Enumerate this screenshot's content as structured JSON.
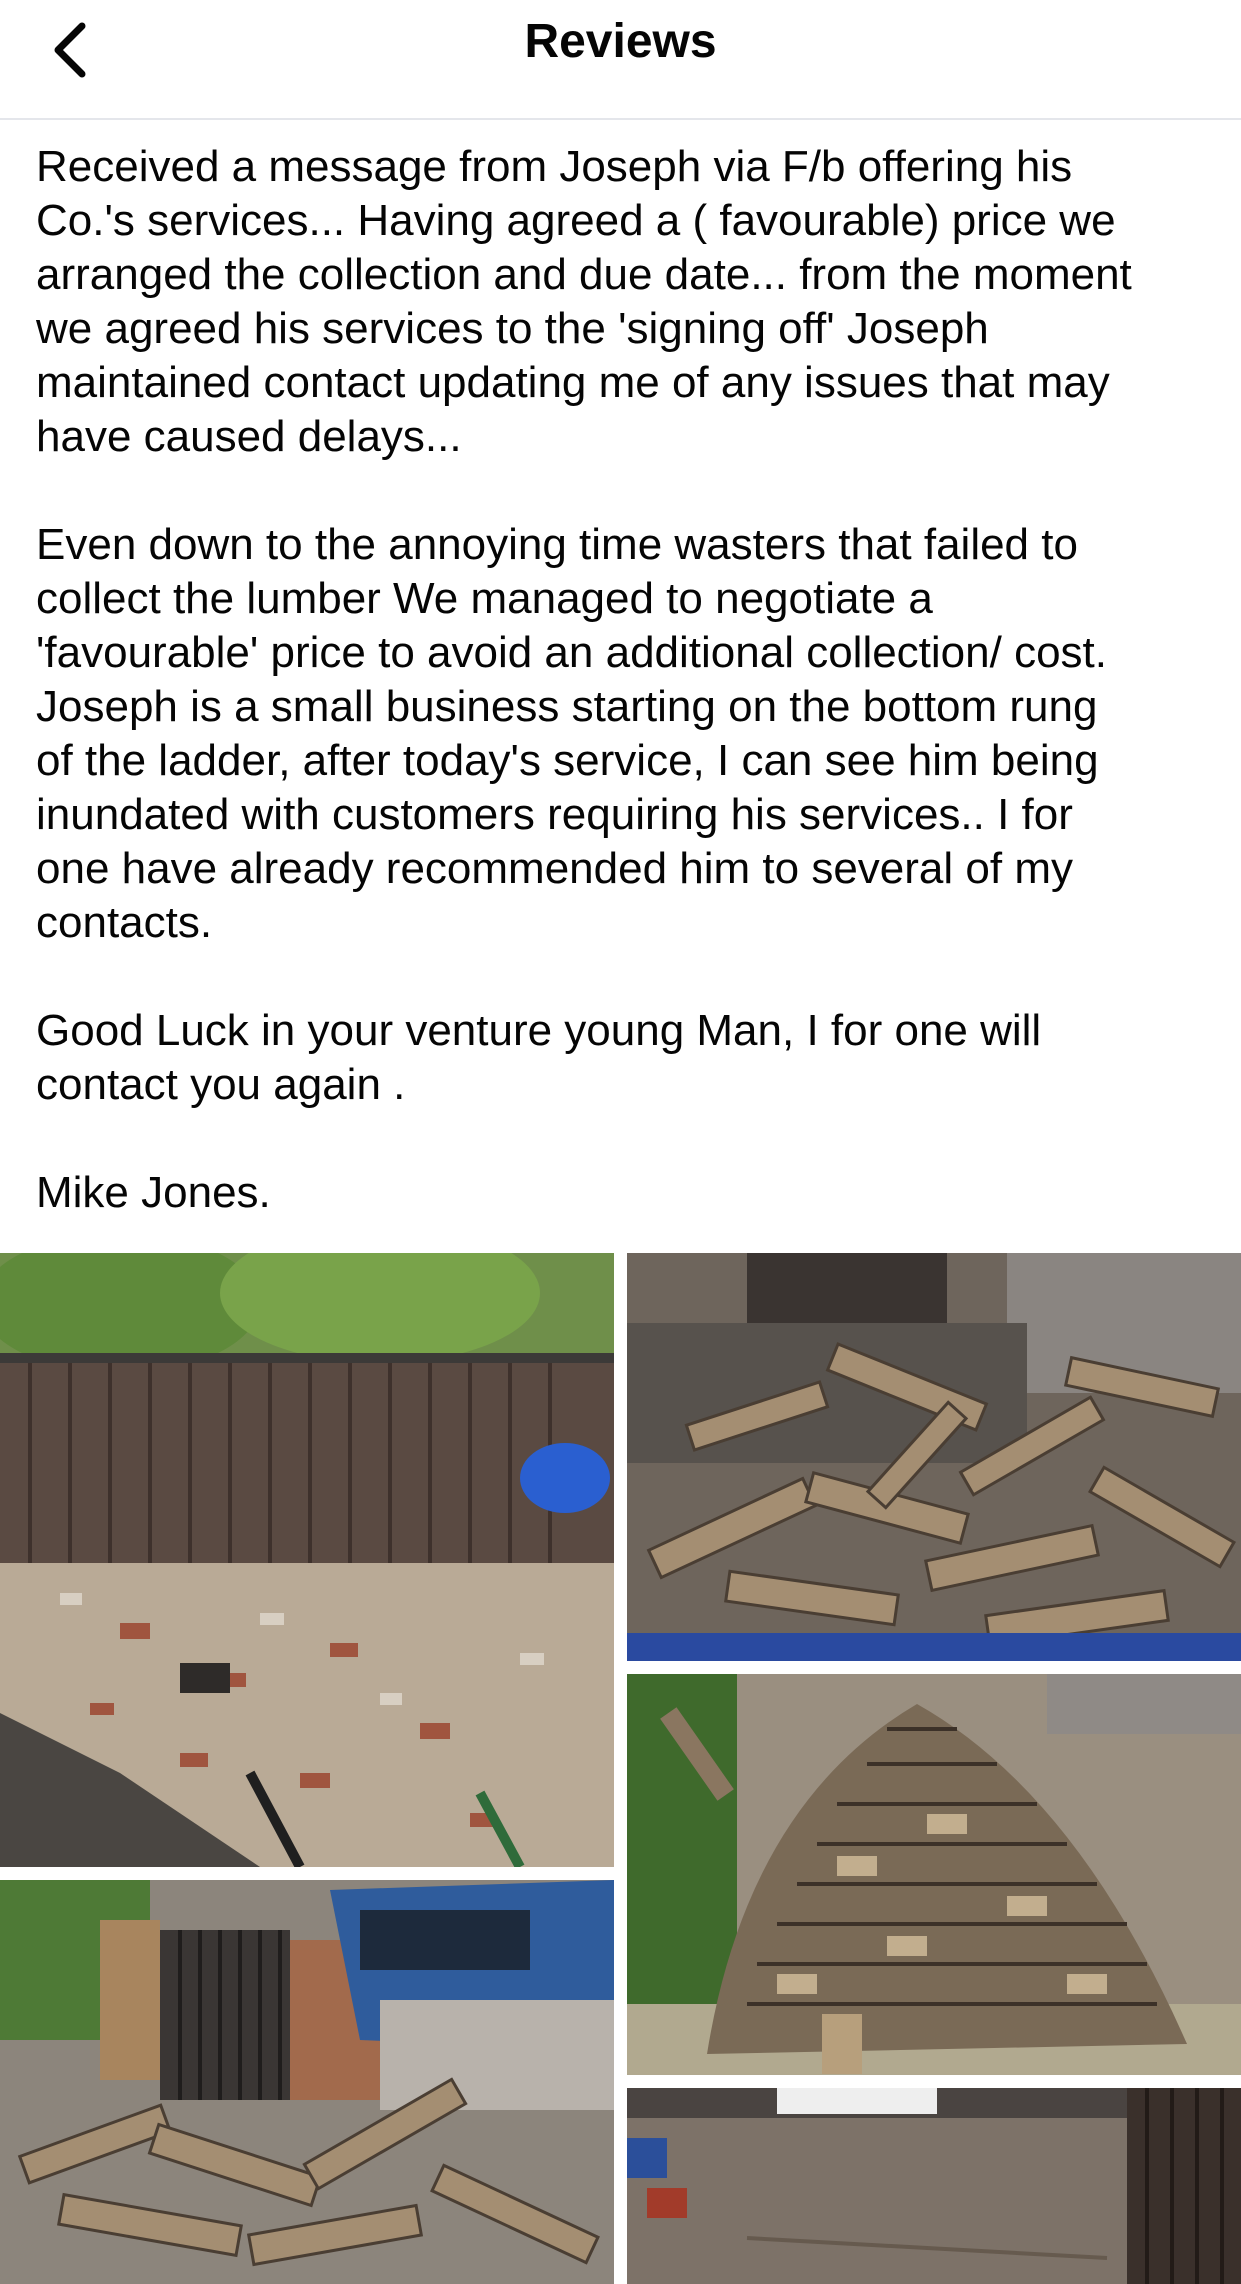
{
  "header": {
    "title": "Reviews",
    "back_icon": "chevron-left-icon"
  },
  "review": {
    "paragraphs": [
      "Received a message from Joseph via F/b offering his\nCo.'s services... Having agreed a ( favourable) price we\narranged the collection and due date... from the moment\nwe agreed his services to the 'signing off' Joseph\nmaintained contact updating me of any issues that may\nhave caused delays...",
      "Even down to the annoying time wasters that failed to\ncollect the lumber We managed to negotiate a\n'favourable' price to avoid an additional collection/ cost.\nJoseph is a small business starting on the bottom rung\nof the ladder, after today's service, I can see him being\ninundated with customers requiring his services..  I for\none have already recommended him to several of my\ncontacts.",
      "Good Luck in your venture young Man, I for one will\ncontact you again .",
      "Mike Jones."
    ]
  },
  "photos": [
    {
      "subject": "garden with rubble and fence",
      "icon": "photo-icon"
    },
    {
      "subject": "pile of wood planks near gate",
      "icon": "photo-icon"
    },
    {
      "subject": "stacked timber pile",
      "icon": "photo-icon"
    },
    {
      "subject": "driveway with blue car and wood",
      "icon": "photo-icon"
    },
    {
      "subject": "cleared yard",
      "icon": "photo-icon"
    }
  ],
  "colors": {
    "background": "#ffffff",
    "text": "#050505",
    "secondary_text": "#65676b"
  }
}
